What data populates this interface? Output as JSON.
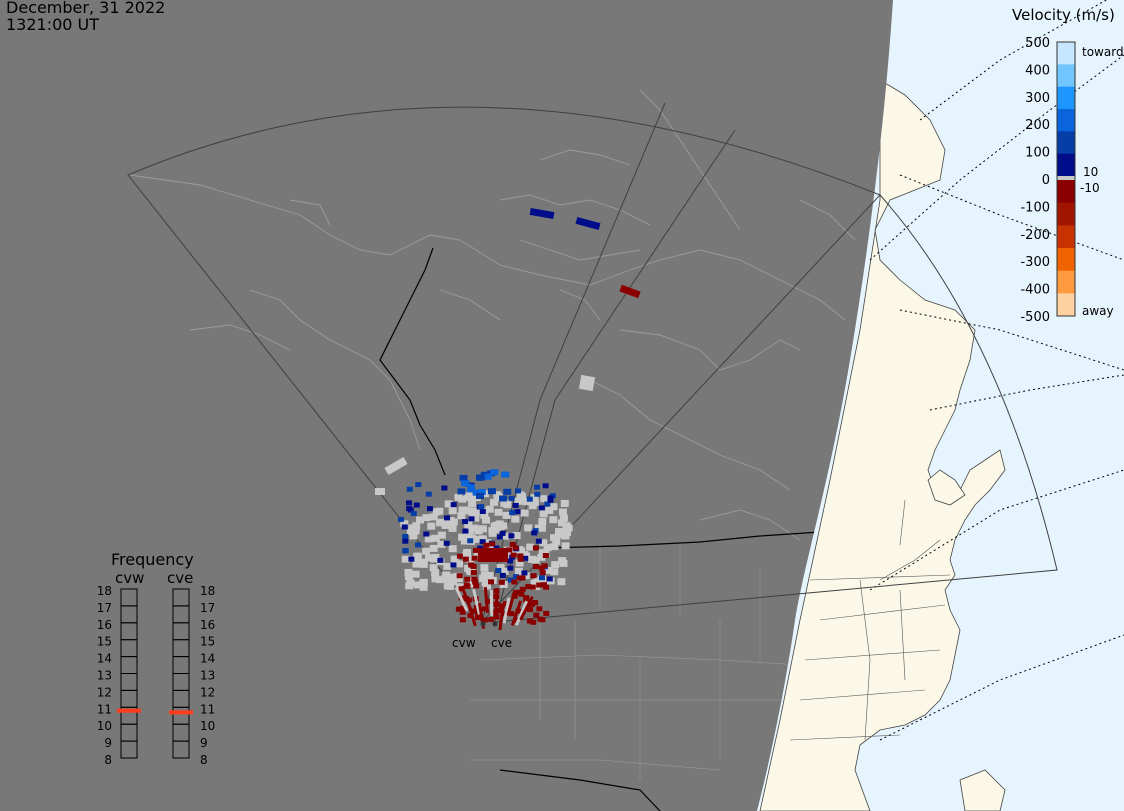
{
  "header": {
    "date": "December, 31 2022",
    "time": "1321:00 UT"
  },
  "velocity_scale": {
    "title": "Velocity (m/s)",
    "ticks": [
      "500",
      "400",
      "300",
      "200",
      "100",
      "0",
      "-100",
      "-200",
      "-300",
      "-400",
      "-500"
    ],
    "small_labels": [
      "10",
      "-10"
    ],
    "toward_label": "toward",
    "away_label": "away",
    "colors": {
      "toward": [
        "#c6e7ff",
        "#72c6ff",
        "#1e96ff",
        "#0a64dc",
        "#063ea8",
        "#000d8a"
      ],
      "near_zero": "#c8c8c8",
      "away": [
        "#8a0000",
        "#a01400",
        "#c83200",
        "#f06400",
        "#ff9a40",
        "#ffd0a0"
      ]
    }
  },
  "frequency_panel": {
    "title": "Frequency",
    "stations": [
      "cvw",
      "cve"
    ],
    "scale": [
      "18",
      "17",
      "16",
      "15",
      "14",
      "13",
      "12",
      "11",
      "10",
      "9",
      "8"
    ],
    "cvw_mhz": 10.8,
    "cve_mhz": 10.7,
    "marker_color": "#ff3c1e"
  },
  "map": {
    "radar_labels": [
      "cvw",
      "cve"
    ],
    "colors": {
      "night": "#787878",
      "day_land": "#fbf8e8",
      "day_ocean": "#e6f4fe",
      "coastline_night": "#9c9c9c",
      "border": "#000000",
      "gray_scatter": "#c8c8c8"
    }
  }
}
